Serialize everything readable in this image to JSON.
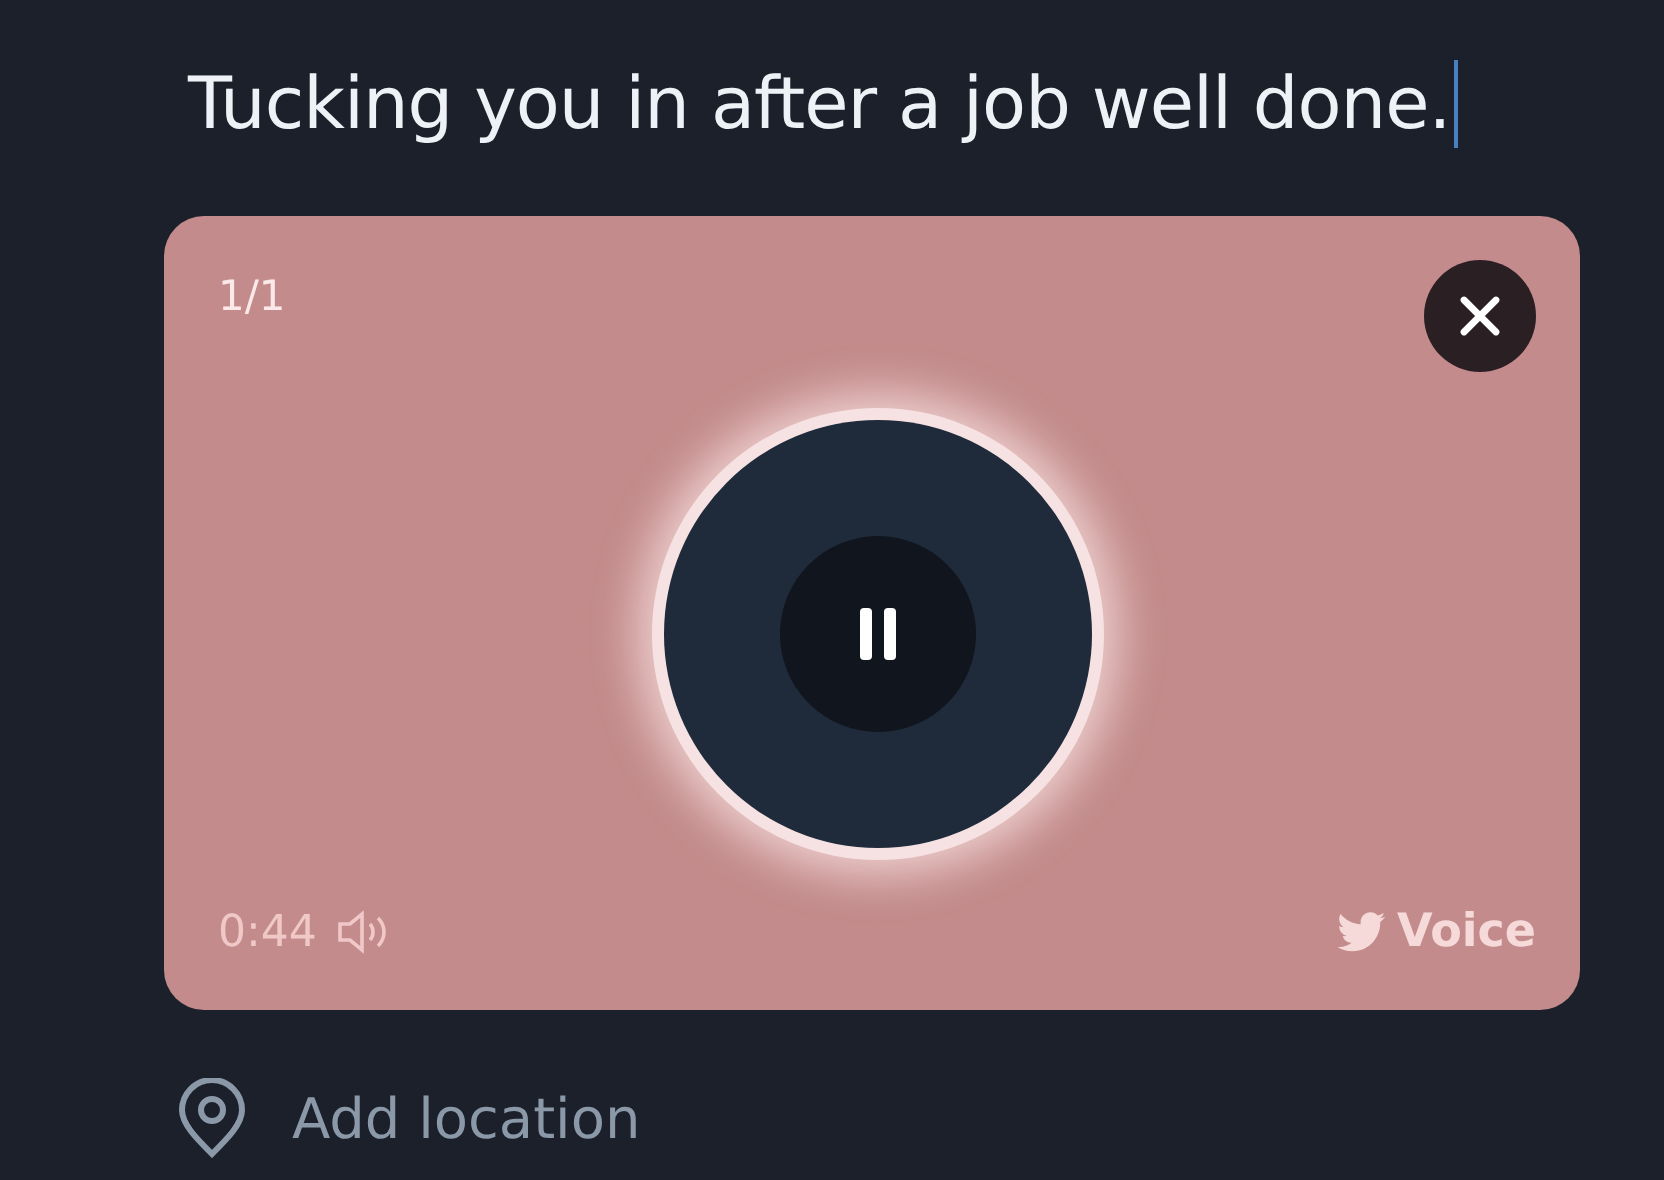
{
  "compose": {
    "text": "Tucking you in after a job well done.",
    "cursor": true
  },
  "voice_card": {
    "counter": "1/1",
    "playing": true,
    "duration": "0:44",
    "brand_label": "Voice"
  },
  "location": {
    "label": "Add location"
  }
}
